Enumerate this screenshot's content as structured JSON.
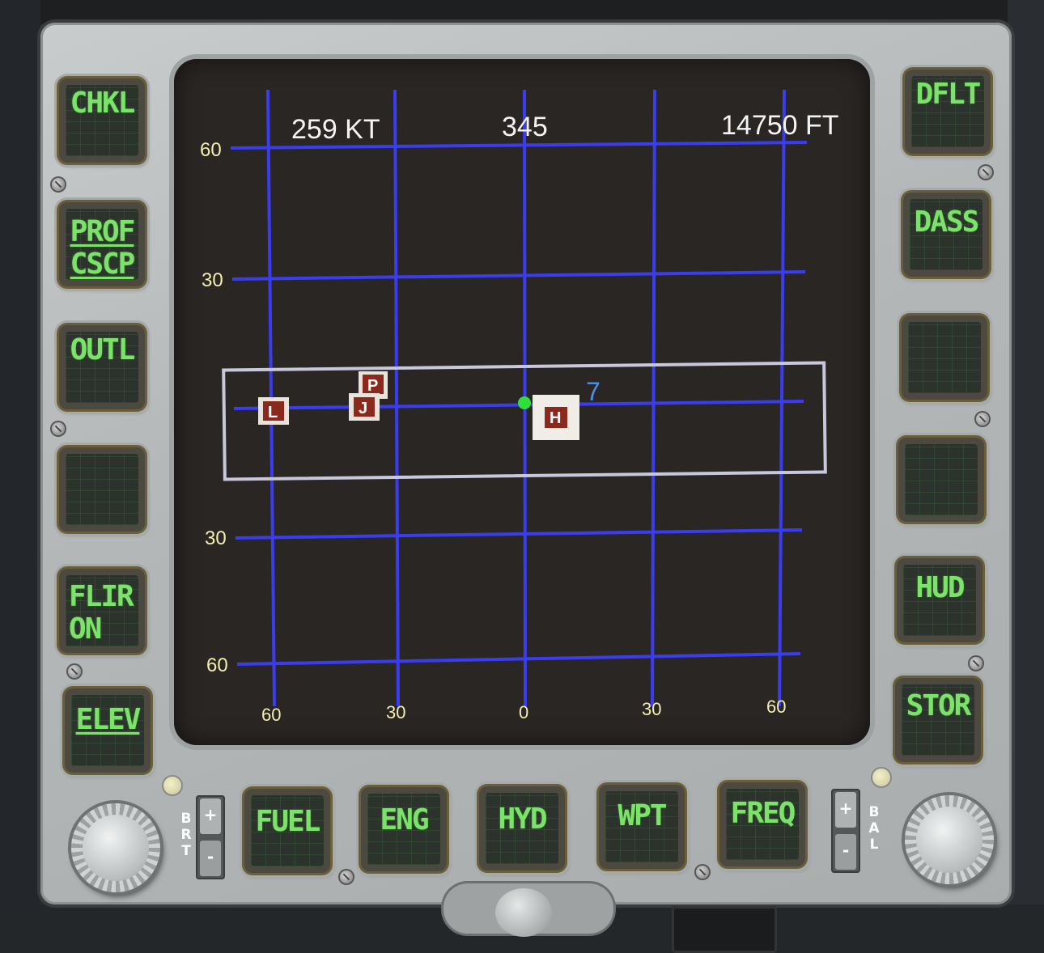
{
  "osb_left": [
    {
      "label": "CHKL"
    },
    {
      "label_line1": "PROF",
      "label_line2": "CSCP"
    },
    {
      "label": "OUTL"
    },
    {
      "label": ""
    },
    {
      "label_line1": "FLIR",
      "label_line2": "ON"
    },
    {
      "label": "ELEV"
    }
  ],
  "osb_right": [
    {
      "label": "DFLT"
    },
    {
      "label": "DASS"
    },
    {
      "label": ""
    },
    {
      "label": ""
    },
    {
      "label": "HUD"
    },
    {
      "label": "STOR"
    }
  ],
  "osb_bottom": [
    {
      "label": "FUEL"
    },
    {
      "label": "ENG"
    },
    {
      "label": "HYD"
    },
    {
      "label": "WPT"
    },
    {
      "label": "FREQ"
    }
  ],
  "display": {
    "speed": "259 KT",
    "heading": "345",
    "altitude": "14750 FT",
    "y_labels": [
      "60",
      "30",
      "30",
      "60"
    ],
    "x_labels": [
      "60",
      "30",
      "0",
      "30",
      "60"
    ],
    "marker_L": "L",
    "marker_P": "P",
    "marker_J": "J",
    "marker_H": "H",
    "track_number": "7"
  },
  "rocker_left": {
    "plus": "+",
    "minus": "-",
    "label": "BRT"
  },
  "rocker_right": {
    "plus": "+",
    "minus": "-",
    "label": "BAL"
  },
  "colors": {
    "grid": "#3a3cf0",
    "scale_text": "#f2eeb0",
    "osb_text": "#7be36a",
    "own_ship": "#2fe03a",
    "marker_bg": "#8b2a1c",
    "track_text": "#4f8fe8"
  }
}
